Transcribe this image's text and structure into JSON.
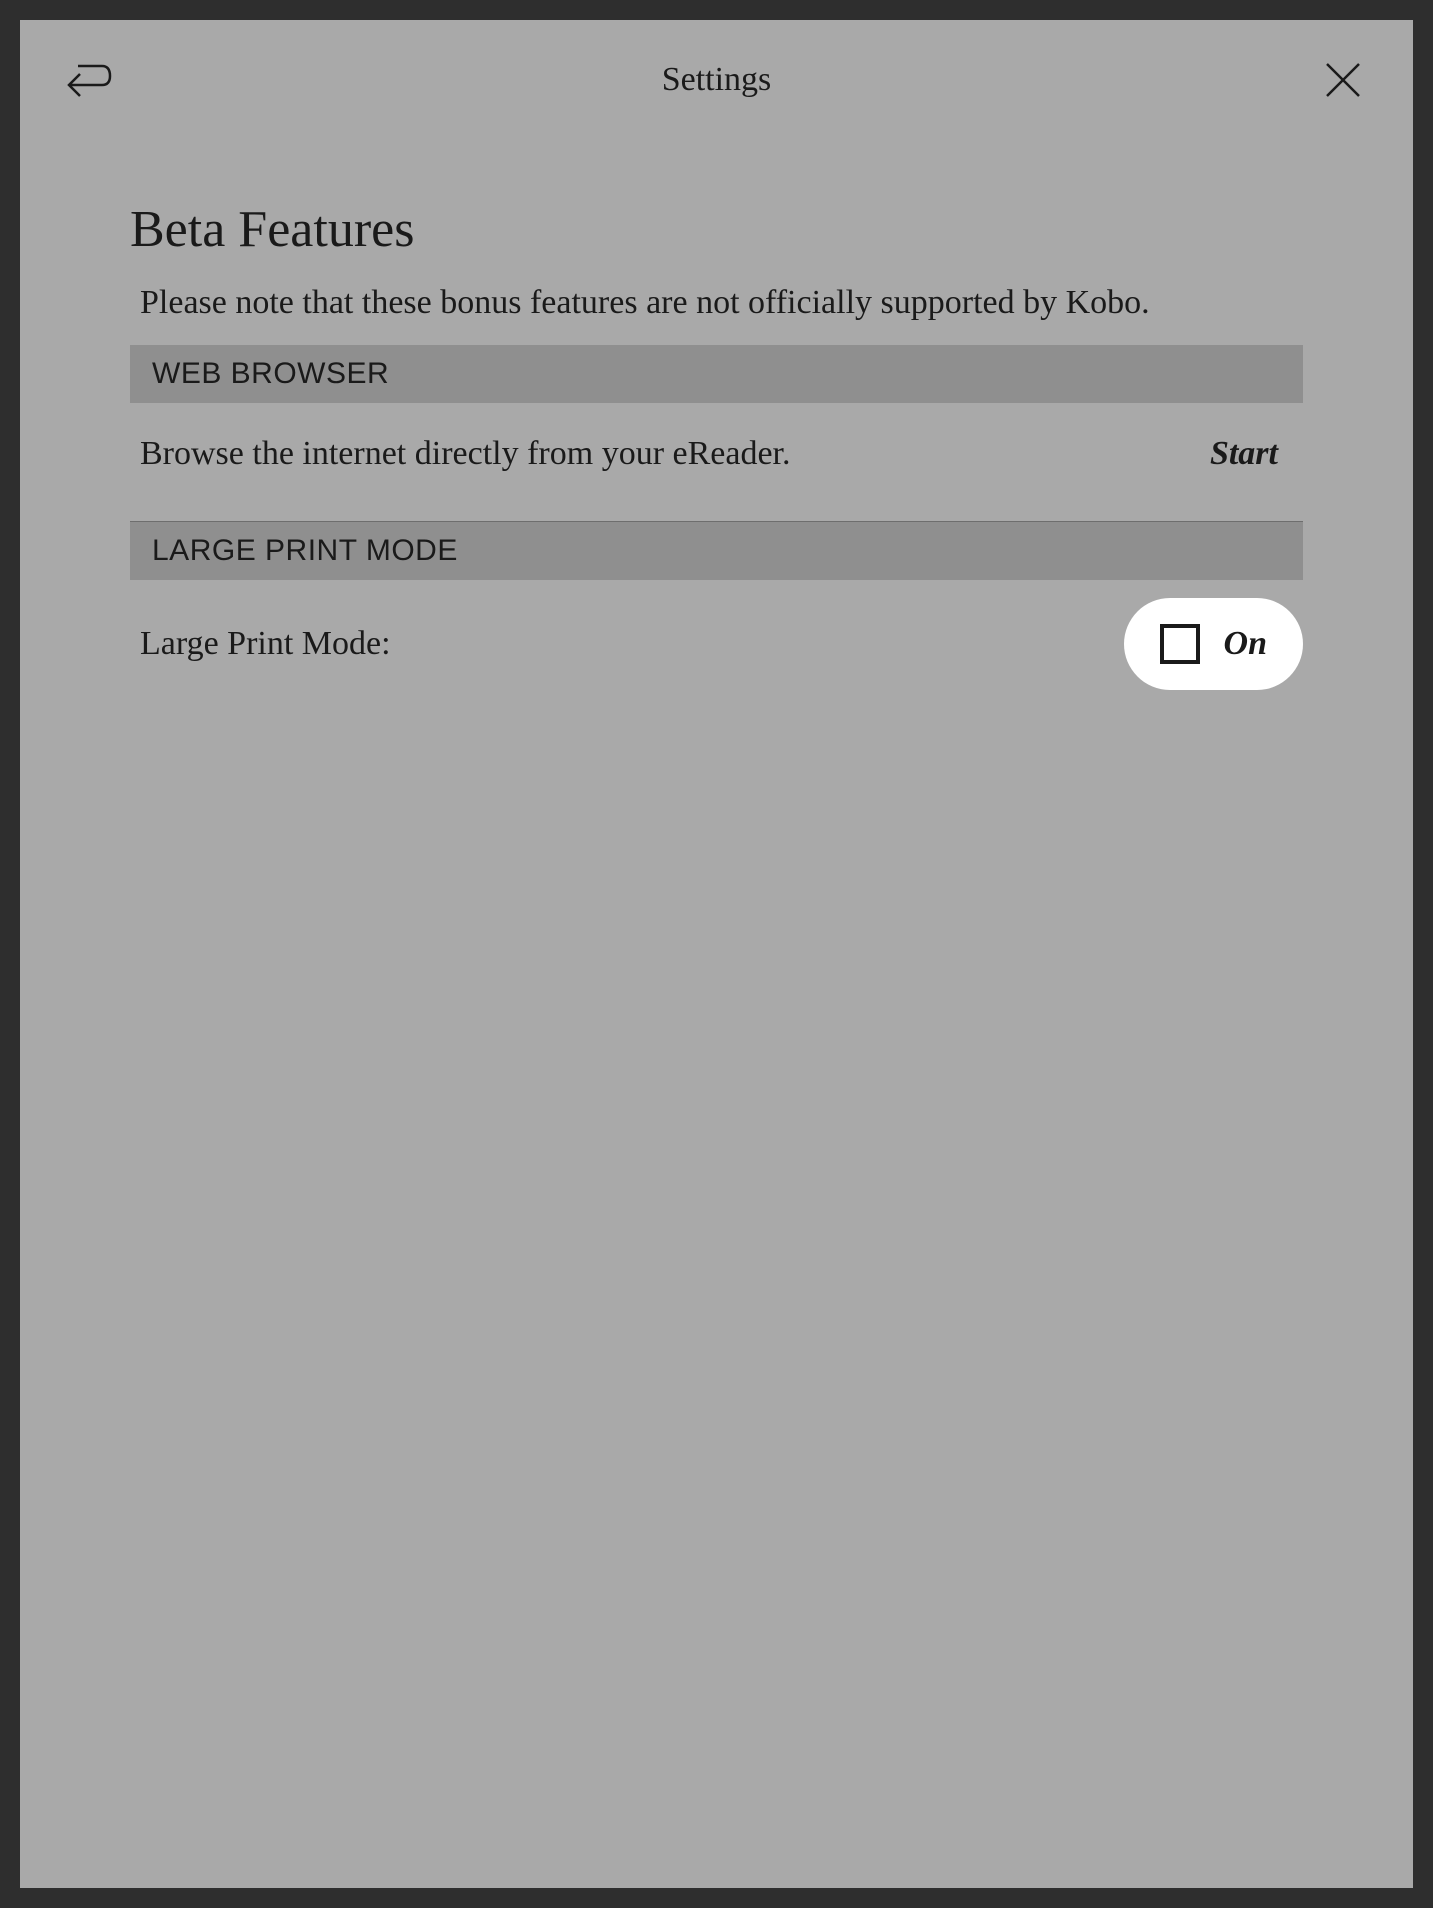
{
  "header": {
    "title": "Settings"
  },
  "page": {
    "title": "Beta Features",
    "description": "Please note that these bonus features are not officially supported by Kobo."
  },
  "sections": {
    "webBrowser": {
      "header": "WEB BROWSER",
      "description": "Browse the internet directly from your eReader.",
      "action": "Start"
    },
    "largePrint": {
      "header": "LARGE PRINT MODE",
      "label": "Large Print Mode:",
      "toggleValue": "On"
    }
  }
}
